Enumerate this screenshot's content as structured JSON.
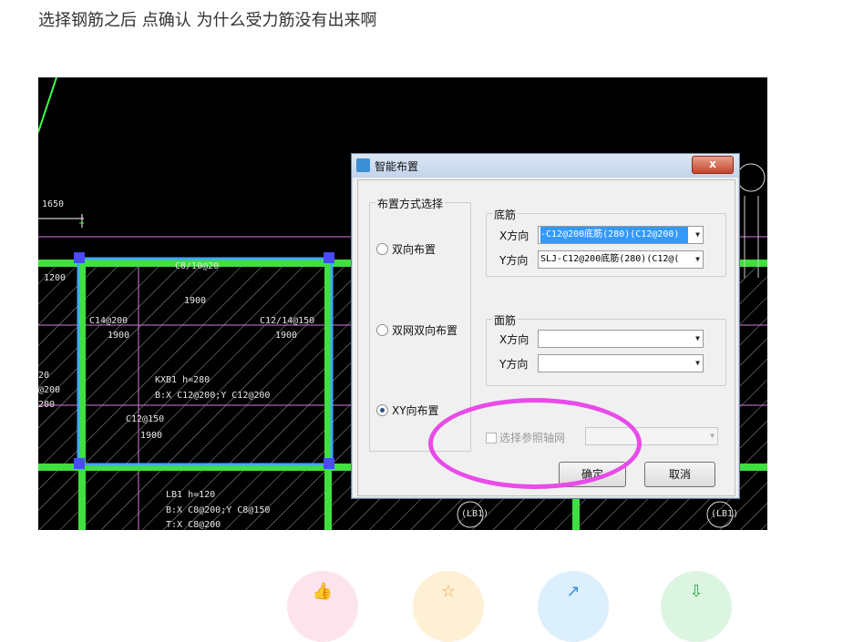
{
  "question": "选择钢筋之后  点确认 为什么受力筋没有出来啊",
  "cad": {
    "labels": [
      "1650",
      "C14@200",
      "1900",
      "C8/10@20",
      "1900",
      "C12/14@150",
      "1900",
      "KXB1 h=280",
      "B:X C12@200;Y C12@200",
      "C12@150",
      "1900",
      "LB1 h=120",
      "B:X C8@200;Y C8@150",
      "T:X C8@200",
      "20",
      "@200",
      "200",
      "1200",
      "(LB1)",
      "(LB1)"
    ]
  },
  "dialog": {
    "title": "智能布置",
    "close_label": "x",
    "layout_group": "布置方式选择",
    "radio_two_way": "双向布置",
    "radio_double_net": "双网双向布置",
    "radio_xy": "XY向布置",
    "bottom_group": "底筋",
    "top_group": "面筋",
    "x_dir": "X方向",
    "y_dir": "Y方向",
    "bottom_x_value": "-C12@200底筋(280)(C12@200)",
    "bottom_y_value": "SLJ-C12@200底筋(280)(C12@(",
    "top_x_value": "",
    "top_y_value": "",
    "ref_axis": "选择参照轴网",
    "ok": "确定",
    "cancel": "取消"
  },
  "colors": {
    "highlight_ellipse": "#e84be8",
    "selection": "#3399ff"
  }
}
